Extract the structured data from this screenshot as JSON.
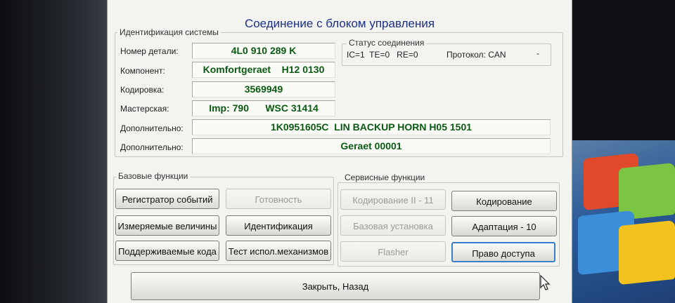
{
  "window": {
    "title": "Соединение с блоком управления"
  },
  "identification": {
    "legend": "Идентификация системы",
    "part_number": {
      "label": "Номер детали:",
      "value": "4L0 910 289 K"
    },
    "component": {
      "label": "Компонент:",
      "value": "Komfortgeraet    H12 0130"
    },
    "coding": {
      "label": "Кодировка:",
      "value": "3569949"
    },
    "workshop": {
      "label": "Мастерская:",
      "value": "Imp: 790      WSC 31414"
    },
    "extra1": {
      "label": "Дополнительно:",
      "value": "1K0951605C  LIN BACKUP HORN H05 1501"
    },
    "extra2": {
      "label": "Дополнительно:",
      "value": "Geraet 00001"
    }
  },
  "connection_status": {
    "legend": "Статус соединения",
    "line": "IC=1  TE=0   RE=0",
    "protocol": "Протокол: CAN",
    "dash": "-"
  },
  "basic_functions": {
    "legend": "Базовые функции",
    "buttons": {
      "event_log": "Регистратор событий",
      "ready": "Готовность",
      "measuring": "Измеряемые величины",
      "identification": "Идентификация",
      "supported_codes": "Поддерживаемые кода",
      "output_test": "Тест испол.механизмов"
    }
  },
  "service_functions": {
    "legend": "Сервисные функции",
    "buttons": {
      "coding2": "Кодирование II - 11",
      "coding": "Кодирование",
      "basic_settings": "Базовая установка",
      "adaptation": "Адаптация - 10",
      "flasher": "Flasher",
      "access": "Право доступа"
    }
  },
  "close_button": "Закрыть, Назад",
  "colors": {
    "title": "#1b2f86",
    "value_text": "#0a5a14",
    "focus": "#3a7ecb"
  }
}
